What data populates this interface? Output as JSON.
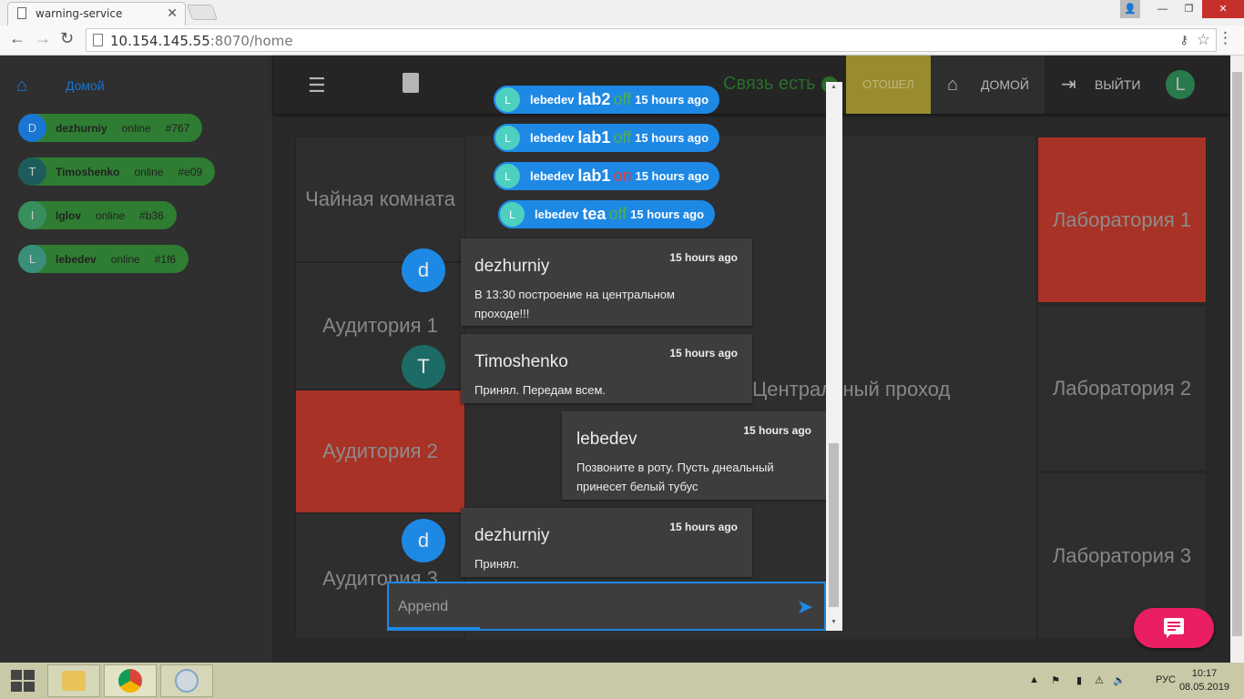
{
  "browser": {
    "tab_title": "warning-service",
    "tab_close": "✕",
    "url_host": "10.154.145.55",
    "url_rest": ":8070/home",
    "window_min": "—",
    "window_max": "❐",
    "window_close": "✕"
  },
  "sidebar": {
    "home_label": "Домой",
    "users": [
      {
        "initial": "D",
        "name": "dezhurniy",
        "status": "online",
        "code": "#767",
        "avatar_color": "#1976d2"
      },
      {
        "initial": "T",
        "name": "Timoshenko",
        "status": "online",
        "code": "#e09",
        "avatar_color": "#1d5c5c"
      },
      {
        "initial": "I",
        "name": "Iglov",
        "status": "online",
        "code": "#b36",
        "avatar_color": "#388e5c"
      },
      {
        "initial": "L",
        "name": "lebedev",
        "status": "online",
        "code": "#1f6",
        "avatar_color": "#3a8f7a"
      }
    ]
  },
  "appbar": {
    "connection": "Связь есть",
    "away_label": "ОТОШЕЛ",
    "home_label": "ДОМОЙ",
    "exit_label": "ВЫЙТИ",
    "avatar_initial": "L"
  },
  "rooms": {
    "tea": "Чайная комната",
    "aud1": "Аудитория 1",
    "aud2": "Аудитория 2",
    "aud3": "Аудитория 3",
    "corridor": "Центральный проход",
    "lab1": "Лаборатория 1",
    "lab2": "Лаборатория 2",
    "lab3": "Лаборатория 3"
  },
  "chat": {
    "log": [
      {
        "initial": "L",
        "user": "lebedev",
        "room": "lab2",
        "state": "off",
        "time": "15 hours ago"
      },
      {
        "initial": "L",
        "user": "lebedev",
        "room": "lab1",
        "state": "off",
        "time": "15 hours ago"
      },
      {
        "initial": "L",
        "user": "lebedev",
        "room": "lab1",
        "state": "on",
        "time": "15 hours ago"
      },
      {
        "initial": "L",
        "user": "lebedev",
        "room": "tea",
        "state": "off",
        "time": "15 hours ago"
      }
    ],
    "messages": [
      {
        "initial": "d",
        "name": "dezhurniy",
        "time": "15 hours ago",
        "text": "В 13:30 построение на центральном проходе!!!",
        "avatar_color": "#1e88e5"
      },
      {
        "initial": "T",
        "name": "Timoshenko",
        "time": "15 hours ago",
        "text": "Принял. Передам всем.",
        "avatar_color": "#1d6b66"
      },
      {
        "initial": "",
        "name": "lebedev",
        "time": "15 hours ago",
        "text": "Позвоните в роту. Пусть днеальный принесет белый тубус",
        "avatar_color": ""
      },
      {
        "initial": "d",
        "name": "dezhurniy",
        "time": "15 hours ago",
        "text": "Принял.",
        "avatar_color": "#1e88e5"
      }
    ],
    "input_placeholder": "Append"
  },
  "taskbar": {
    "lang": "РУС",
    "time": "10:17",
    "date": "08.05.2019"
  }
}
